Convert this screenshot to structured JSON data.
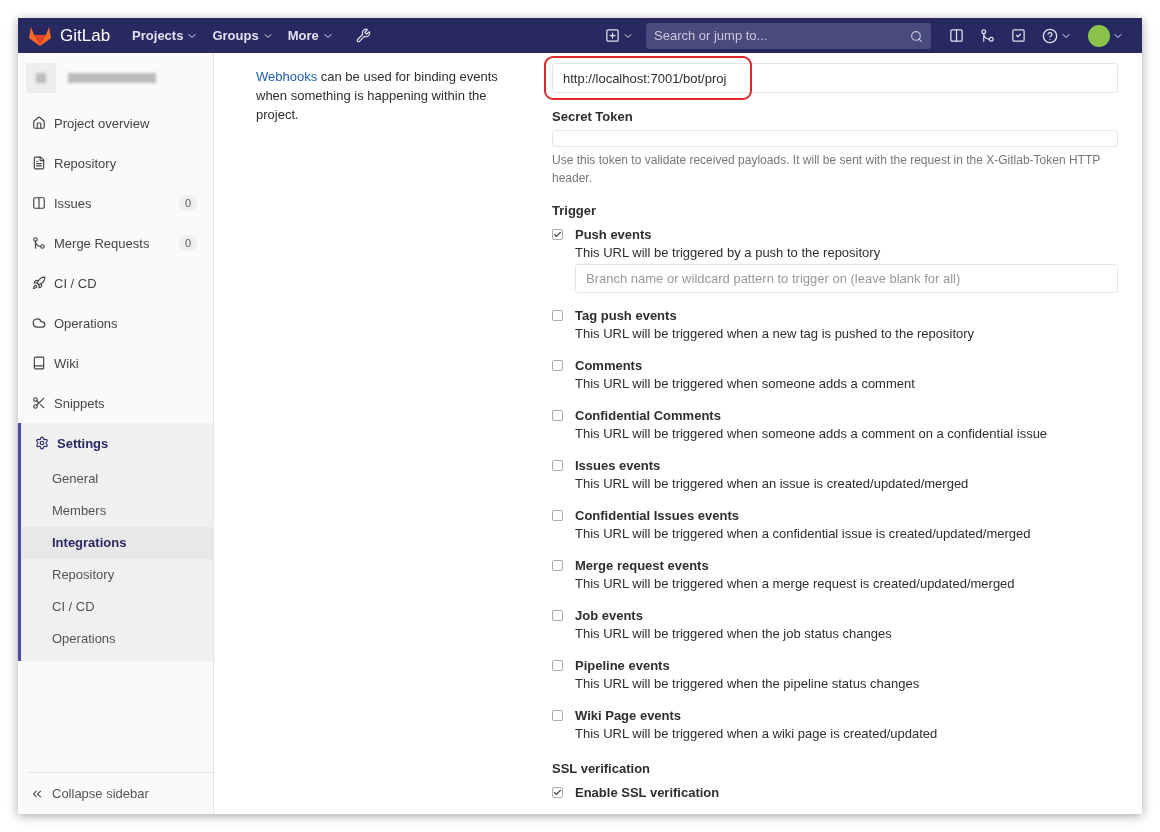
{
  "navbar": {
    "brand": "GitLab",
    "menus": [
      {
        "label": "Projects"
      },
      {
        "label": "Groups"
      },
      {
        "label": "More"
      }
    ],
    "search": {
      "placeholder": "Search or jump to..."
    }
  },
  "sidebar": {
    "items": [
      {
        "label": "Project overview",
        "selected": false
      },
      {
        "label": "Repository",
        "selected": false
      },
      {
        "label": "Issues",
        "count": "0",
        "selected": false
      },
      {
        "label": "Merge Requests",
        "count": "0",
        "selected": false
      },
      {
        "label": "CI / CD",
        "selected": false
      },
      {
        "label": "Operations",
        "selected": false
      },
      {
        "label": "Wiki",
        "selected": false
      },
      {
        "label": "Snippets",
        "selected": false
      },
      {
        "label": "Settings",
        "selected": true,
        "children": [
          {
            "label": "General",
            "selected": false
          },
          {
            "label": "Members",
            "selected": false
          },
          {
            "label": "Integrations",
            "selected": true
          },
          {
            "label": "Repository",
            "selected": false
          },
          {
            "label": "CI / CD",
            "selected": false
          },
          {
            "label": "Operations",
            "selected": false
          }
        ]
      }
    ],
    "collapse": "Collapse sidebar"
  },
  "intro": {
    "link": "Webhooks",
    "text": " can be used for binding events when something is happening within the project."
  },
  "url_field": {
    "value": "http://localhost:7001/bot/proj",
    "highlighted": true
  },
  "secret_token": {
    "label": "Secret Token",
    "help": "Use this token to validate received payloads. It will be sent with the request in the X-Gitlab-Token HTTP header."
  },
  "trigger": {
    "label": "Trigger",
    "events": [
      {
        "title": "Push events",
        "description": "This URL will be triggered by a push to the repository",
        "checked": true,
        "branch_placeholder": "Branch name or wildcard pattern to trigger on (leave blank for all)"
      },
      {
        "title": "Tag push events",
        "description": "This URL will be triggered when a new tag is pushed to the repository",
        "checked": false
      },
      {
        "title": "Comments",
        "description": "This URL will be triggered when someone adds a comment",
        "checked": false
      },
      {
        "title": "Confidential Comments",
        "description": "This URL will be triggered when someone adds a comment on a confidential issue",
        "checked": false
      },
      {
        "title": "Issues events",
        "description": "This URL will be triggered when an issue is created/updated/merged",
        "checked": false
      },
      {
        "title": "Confidential Issues events",
        "description": "This URL will be triggered when a confidential issue is created/updated/merged",
        "checked": false
      },
      {
        "title": "Merge request events",
        "description": "This URL will be triggered when a merge request is created/updated/merged",
        "checked": false
      },
      {
        "title": "Job events",
        "description": "This URL will be triggered when the job status changes",
        "checked": false
      },
      {
        "title": "Pipeline events",
        "description": "This URL will be triggered when the pipeline status changes",
        "checked": false
      },
      {
        "title": "Wiki Page events",
        "description": "This URL will be triggered when a wiki page is created/updated",
        "checked": false
      }
    ]
  },
  "ssl": {
    "label": "SSL verification",
    "option": "Enable SSL verification",
    "checked": true
  }
}
